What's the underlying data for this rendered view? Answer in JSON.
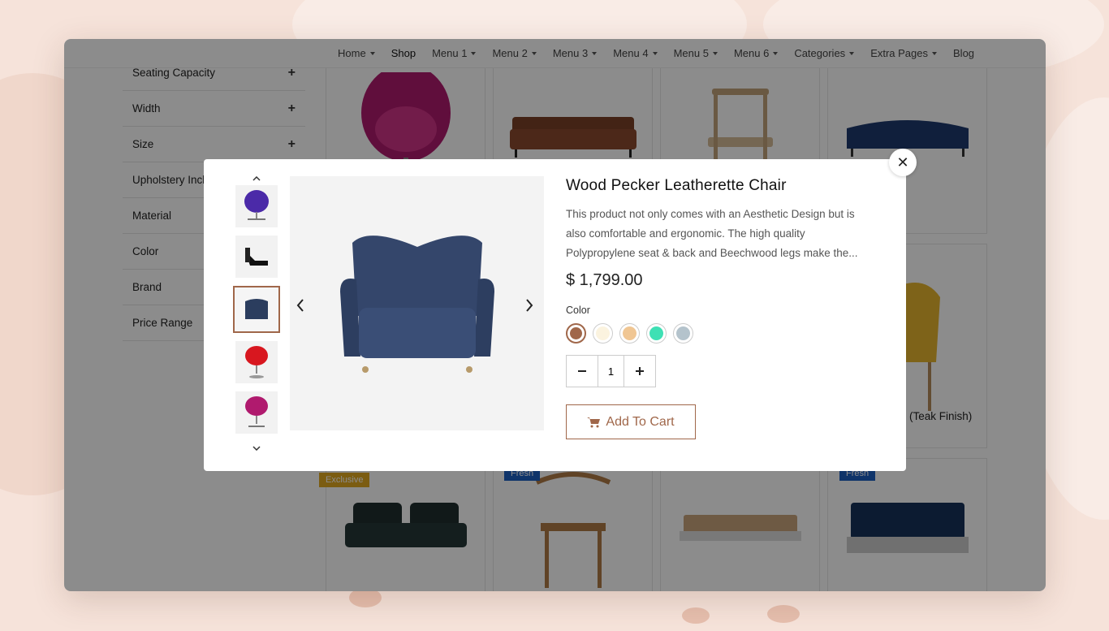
{
  "nav": {
    "items": [
      {
        "label": "Home",
        "caret": true,
        "active": false
      },
      {
        "label": "Shop",
        "caret": false,
        "active": true
      },
      {
        "label": "Menu 1",
        "caret": true,
        "active": false
      },
      {
        "label": "Menu 2",
        "caret": true,
        "active": false
      },
      {
        "label": "Menu 3",
        "caret": true,
        "active": false
      },
      {
        "label": "Menu 4",
        "caret": true,
        "active": false
      },
      {
        "label": "Menu 5",
        "caret": true,
        "active": false
      },
      {
        "label": "Menu 6",
        "caret": true,
        "active": false
      },
      {
        "label": "Categories",
        "caret": true,
        "active": false
      },
      {
        "label": "Extra Pages",
        "caret": true,
        "active": false
      },
      {
        "label": "Blog",
        "caret": false,
        "active": false
      }
    ]
  },
  "sidebar": {
    "filters": [
      {
        "label": "Seating Capacity"
      },
      {
        "label": "Width"
      },
      {
        "label": "Size"
      },
      {
        "label": "Upholstery Included"
      },
      {
        "label": "Material"
      },
      {
        "label": "Color"
      },
      {
        "label": "Brand"
      },
      {
        "label": "Price Range"
      }
    ],
    "expand_icon": "plus-icon"
  },
  "grid": {
    "partial_title": "(Teak Finish)",
    "ribbons": {
      "exclusive": "Exclusive",
      "fresh": "Fresh"
    }
  },
  "modal": {
    "title": "Wood Pecker Leatherette Chair",
    "description": "This product not only comes with an Aesthetic Design but is also comfortable and ergonomic. The high quality Polypropylene seat & back and Beechwood legs make the...",
    "price": "$ 1,799.00",
    "color_label": "Color",
    "colors": [
      "#a0674a",
      "#fbf3df",
      "#f0c693",
      "#3ee0b4",
      "#b4c3cc"
    ],
    "selected_color_index": 0,
    "quantity": "1",
    "add_to_cart": "Add To Cart",
    "close_icon": "close-icon",
    "selected_thumb_index": 2
  },
  "colors": {
    "accent": "#a0674a",
    "overlay": "rgba(0,0,0,0.45)"
  }
}
